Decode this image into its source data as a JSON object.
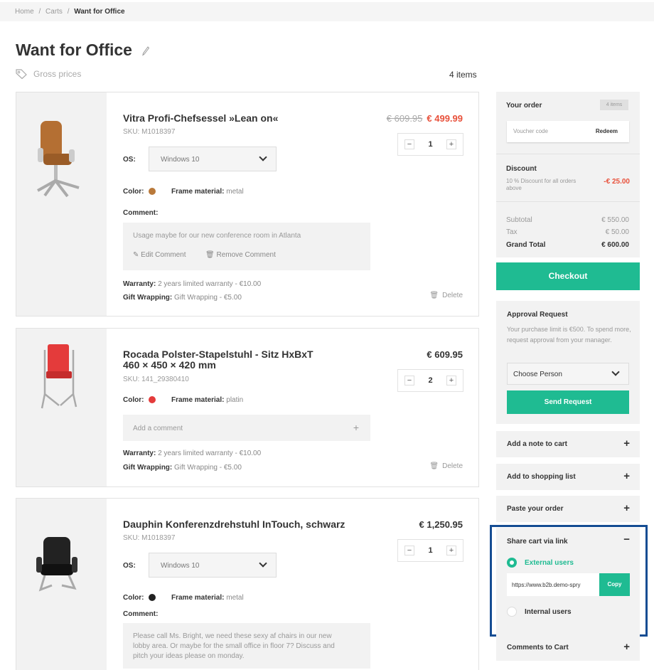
{
  "breadcrumb": {
    "home": "Home",
    "sep1": "/",
    "carts": "Carts",
    "sep2": "/",
    "current": "Want for Office"
  },
  "page": {
    "title": "Want for Office",
    "gross_prices": "Gross prices",
    "item_count": "4 items"
  },
  "colors": {
    "accent": "#1fbb92",
    "sale": "#e8503a",
    "highlight_border": "#154d93"
  },
  "products": [
    {
      "name": "Vitra Profi-Chefsessel »Lean on«",
      "sku": "SKU: M1018397",
      "old_price": "€ 609.95",
      "price": "€ 499.99",
      "quantity": "1",
      "os_label": "OS:",
      "os_value": "Windows 10",
      "color_label": "Color:",
      "color_hex": "#b9793a",
      "frame_label": "Frame material:",
      "frame_value": "metal",
      "comment_label": "Comment:",
      "comment_text": "Usage maybe for our new conference room in Atlanta",
      "edit_comment": "Edit Comment",
      "remove_comment": "Remove Comment",
      "warranty_label": "Warranty:",
      "warranty_value": "2 years limited warranty - €10.00",
      "gift_label": "Gift Wrapping:",
      "gift_value": "Gift Wrapping - €5.00",
      "delete": "Delete"
    },
    {
      "name_line1": "Rocada Polster-Stapelstuhl - Sitz HxBxT",
      "name_line2": "460 × 450 × 420 mm",
      "sku": "SKU: 141_29380410",
      "price": "€ 609.95",
      "quantity": "2",
      "color_label": "Color:",
      "color_hex": "#e43b3b",
      "frame_label": "Frame material:",
      "frame_value": "platin",
      "add_comment": "Add a comment",
      "warranty_label": "Warranty:",
      "warranty_value": "2 years limited warranty - €10.00",
      "gift_label": "Gift Wrapping:",
      "gift_value": "Gift Wrapping - €5.00",
      "delete": "Delete"
    },
    {
      "name": "Dauphin Konferenzdrehstuhl InTouch, schwarz",
      "sku": "SKU: M1018397",
      "price": "€ 1,250.95",
      "quantity": "1",
      "os_label": "OS:",
      "os_value": "Windows 10",
      "color_label": "Color:",
      "color_hex": "#222222",
      "frame_label": "Frame material:",
      "frame_value": "metal",
      "comment_label": "Comment:",
      "comment_text": "Please call Ms. Bright, we need these sexy af chairs in our new lobby area. Or maybe for the small office in floor 7? Discuss and pitch your ideas please on monday."
    }
  ],
  "sidebar": {
    "your_order": "Your order",
    "order_items_badge": "4 items",
    "voucher_placeholder": "Voucher code",
    "redeem": "Redeem",
    "discount_title": "Discount",
    "discount_desc": "10 % Discount for all orders above",
    "discount_value": "-€ 25.00",
    "subtotal_label": "Subtotal",
    "subtotal_value": "€ 550.00",
    "tax_label": "Tax",
    "tax_value": "€ 50.00",
    "grand_total_label": "Grand Total",
    "grand_total_value": "€ 600.00",
    "checkout": "Checkout",
    "approval_title": "Approval Request",
    "approval_desc": "Your purchase limit is €500. To spend more, request approval from your manager.",
    "choose_person": "Choose Person",
    "send_request": "Send Request",
    "add_note": "Add a note to cart",
    "add_shopping_list": "Add to shopping list",
    "paste_order": "Paste your order",
    "share_title": "Share cart via link",
    "external_users": "External users",
    "share_url": "https://www.b2b.demo-spry",
    "copy": "Copy",
    "internal_users": "Internal users",
    "comments_to_cart": "Comments to Cart"
  }
}
